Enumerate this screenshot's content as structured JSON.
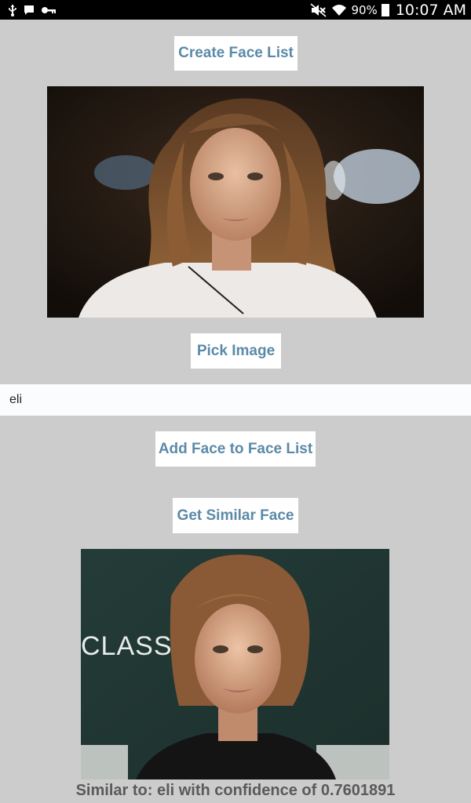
{
  "status_bar": {
    "battery": "90%",
    "time": "10:07 AM",
    "icons_left": [
      "usb-icon",
      "message-icon",
      "key-icon"
    ],
    "icons_right": [
      "mute-icon",
      "wifi-icon",
      "battery-icon"
    ]
  },
  "buttons": {
    "create_face_list": "Create Face List",
    "pick_image": "Pick Image",
    "add_face": "Add Face to Face List",
    "get_similar": "Get Similar Face"
  },
  "name_input": {
    "value": "eli"
  },
  "result": {
    "text": "Similar to: eli with confidence of 0.7601891"
  },
  "result_photo_banner_text": "CLASSICS",
  "colors": {
    "background": "#cccccc",
    "button_text": "#5b8aa8",
    "button_bg": "#ffffff",
    "status_bar": "#000000"
  }
}
